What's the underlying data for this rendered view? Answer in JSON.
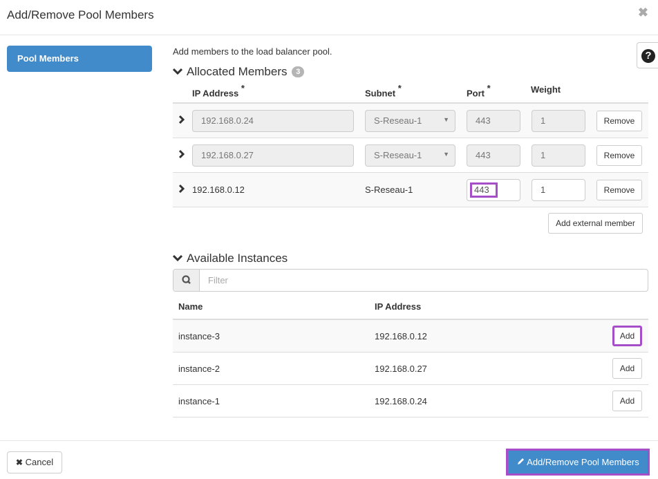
{
  "modal": {
    "title": "Add/Remove Pool Members",
    "close_icon": "close-icon"
  },
  "sidebar": {
    "items": [
      {
        "label": "Pool Members",
        "active": true
      }
    ]
  },
  "help": {
    "icon": "question-circle-icon",
    "glyph": "?"
  },
  "description": "Add members to the load balancer pool.",
  "allocated": {
    "title": "Allocated Members",
    "count": "3",
    "columns": {
      "ip": "IP Address",
      "subnet": "Subnet",
      "port": "Port",
      "weight": "Weight",
      "required_mark": "*"
    },
    "rows": [
      {
        "ip": "192.168.0.24",
        "subnet": "S-Reseau-1",
        "port": "443",
        "weight": "1",
        "remove_label": "Remove",
        "disabled": true
      },
      {
        "ip": "192.168.0.27",
        "subnet": "S-Reseau-1",
        "port": "443",
        "weight": "1",
        "remove_label": "Remove",
        "disabled": true
      },
      {
        "ip": "192.168.0.12",
        "subnet": "S-Reseau-1",
        "port": "443",
        "weight": "1",
        "remove_label": "Remove",
        "disabled": false
      }
    ],
    "add_external_label": "Add external member"
  },
  "available": {
    "title": "Available Instances",
    "filter_placeholder": "Filter",
    "columns": {
      "name": "Name",
      "ip": "IP Address"
    },
    "rows": [
      {
        "name": "instance-3",
        "ip": "192.168.0.12",
        "add_label": "Add"
      },
      {
        "name": "instance-2",
        "ip": "192.168.0.27",
        "add_label": "Add"
      },
      {
        "name": "instance-1",
        "ip": "192.168.0.24",
        "add_label": "Add"
      }
    ]
  },
  "footer": {
    "cancel_label": "Cancel",
    "submit_label": "Add/Remove Pool Members"
  },
  "colors": {
    "primary": "#428bca",
    "highlight": "#a64dc8"
  }
}
